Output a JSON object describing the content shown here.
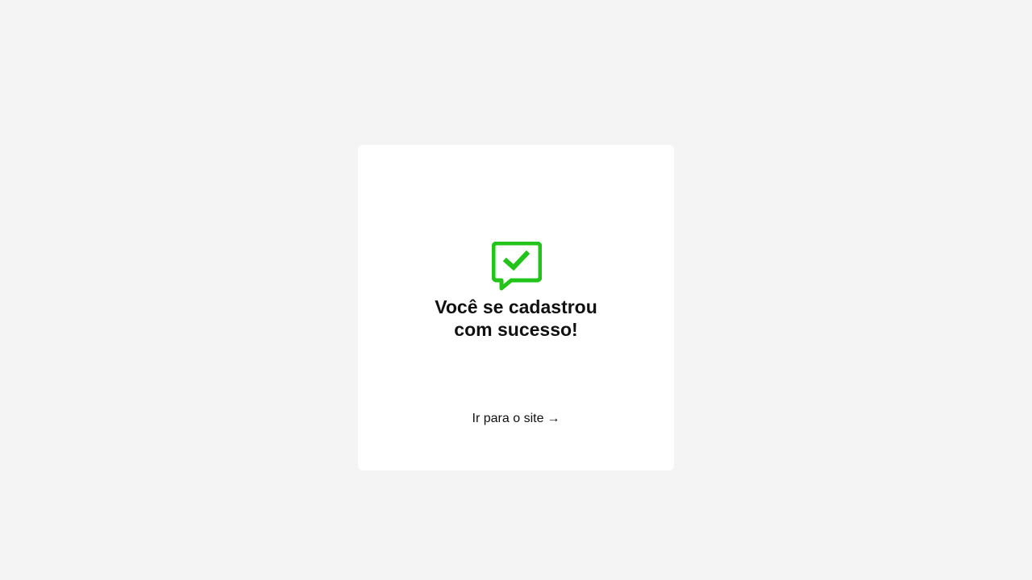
{
  "colors": {
    "background": "#f4f4f4",
    "card": "#ffffff",
    "accent": "#22c41a",
    "text": "#111111"
  },
  "success": {
    "icon": "chat-check-icon",
    "title_line1": "Você se cadastrou",
    "title_line2": "com sucesso!"
  },
  "link": {
    "label": "Ir para o site",
    "arrow": "→",
    "arrow_icon": "arrow-right-icon"
  }
}
